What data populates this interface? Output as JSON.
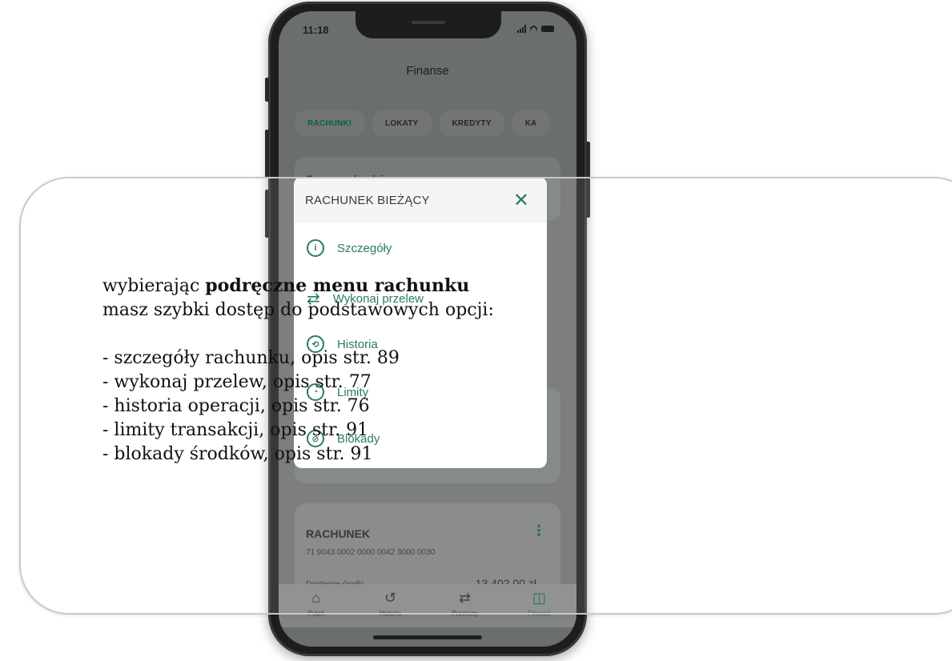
{
  "phone": {
    "status_bar": {
      "time": "11:18"
    },
    "header": {
      "title": "Finanse"
    },
    "tabs": [
      "RACHUNKI",
      "LOKATY",
      "KREDYTY",
      "KA"
    ],
    "sum_card": {
      "label": "Suma rachunków"
    },
    "account": {
      "title": "RACHUNEK",
      "number": "71 9043 0002 0000 0042 3000 0030",
      "available_label": "Dostępne środki",
      "available_value": "13 402,00 zł"
    },
    "bottom_nav": [
      {
        "label": "Pulpit",
        "icon": "home-icon",
        "active": false
      },
      {
        "label": "Historia",
        "icon": "history-icon",
        "active": false
      },
      {
        "label": "Przelewy",
        "icon": "transfer-icon",
        "active": false
      },
      {
        "label": "Finanse",
        "icon": "finance-icon",
        "active": true
      }
    ]
  },
  "modal": {
    "title": "RACHUNEK BIEŻĄCY",
    "items": [
      {
        "label": "Szczegóły",
        "icon": "info-icon"
      },
      {
        "label": "Wykonaj przelew",
        "icon": "transfer-arrows-icon"
      },
      {
        "label": "Historia",
        "icon": "history-icon"
      },
      {
        "label": "Limity",
        "icon": "limit-icon"
      },
      {
        "label": "Blokady",
        "icon": "block-icon"
      }
    ]
  },
  "description": {
    "line1_prefix": "wybierając ",
    "line1_bold": "podręczne menu rachunku",
    "line2": "masz szybki dostęp do podstawowych opcji:",
    "bullets": [
      "- szczegóły rachunku, opis str. 89",
      "- wykonaj przelew, opis str. 77",
      "- historia operacji, opis str. 76",
      "- limity transakcji, opis str. 91",
      "- blokady środków, opis str. 91"
    ]
  },
  "colors": {
    "accent": "#0d6b43",
    "dim_overlay": "#6a6e6c",
    "frame_border": "#c9c9c9"
  }
}
